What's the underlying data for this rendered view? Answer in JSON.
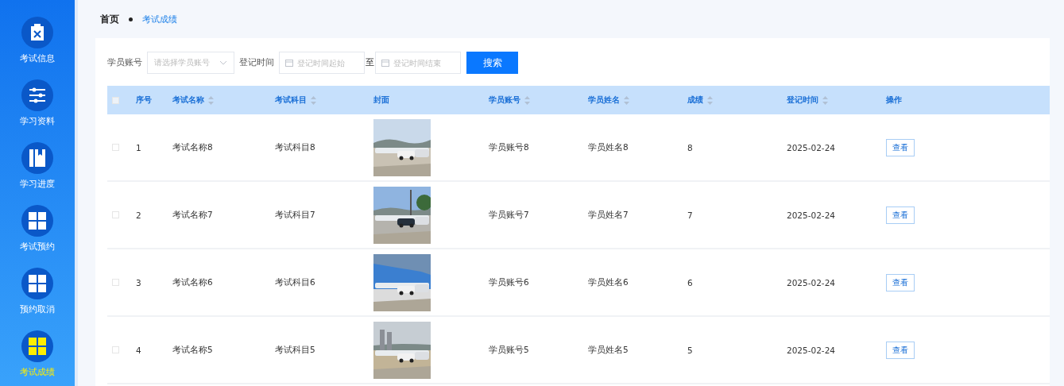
{
  "sidebar": {
    "items": [
      {
        "label": "考试信息",
        "selected": false
      },
      {
        "label": "学习资料",
        "selected": false
      },
      {
        "label": "学习进度",
        "selected": false
      },
      {
        "label": "考试预约",
        "selected": false
      },
      {
        "label": "预约取消",
        "selected": false
      },
      {
        "label": "考试成绩",
        "selected": true
      }
    ]
  },
  "breadcrumb": {
    "home": "首页",
    "current": "考试成绩"
  },
  "search": {
    "account_label": "学员账号",
    "account_placeholder": "请选择学员账号",
    "time_label": "登记时间",
    "start_placeholder": "登记时间起始",
    "to": "至",
    "end_placeholder": "登记时间结束",
    "button": "搜索"
  },
  "table": {
    "select_all": {
      "checked": false
    },
    "columns": [
      {
        "label": "序号",
        "sortable": false,
        "kind": "text"
      },
      {
        "label": "考试名称",
        "sortable": true,
        "kind": "text"
      },
      {
        "label": "考试科目",
        "sortable": true,
        "kind": "text"
      },
      {
        "label": "封面",
        "sortable": false,
        "kind": "picture"
      },
      {
        "label": "学员账号",
        "sortable": true,
        "kind": "text"
      },
      {
        "label": "学员姓名",
        "sortable": true,
        "kind": "text"
      },
      {
        "label": "成绩",
        "sortable": true,
        "kind": "text"
      },
      {
        "label": "登记时间",
        "sortable": true,
        "kind": "text"
      },
      {
        "label": "操作",
        "sortable": false,
        "kind": "button"
      }
    ],
    "rows": [
      {
        "checked": false,
        "cells": [
          "1",
          "考试名称8",
          "考试科目8",
          "",
          "学员账号8",
          "学员姓名8",
          "8",
          "2025-02-24",
          "查看"
        ]
      },
      {
        "checked": false,
        "cells": [
          "2",
          "考试名称7",
          "考试科目7",
          "",
          "学员账号7",
          "学员姓名7",
          "7",
          "2025-02-24",
          "查看"
        ]
      },
      {
        "checked": false,
        "cells": [
          "3",
          "考试名称6",
          "考试科目6",
          "",
          "学员账号6",
          "学员姓名6",
          "6",
          "2025-02-24",
          "查看"
        ]
      },
      {
        "checked": false,
        "cells": [
          "4",
          "考试名称5",
          "考试科目5",
          "",
          "学员账号5",
          "学员姓名5",
          "5",
          "2025-02-24",
          "查看"
        ]
      }
    ]
  }
}
